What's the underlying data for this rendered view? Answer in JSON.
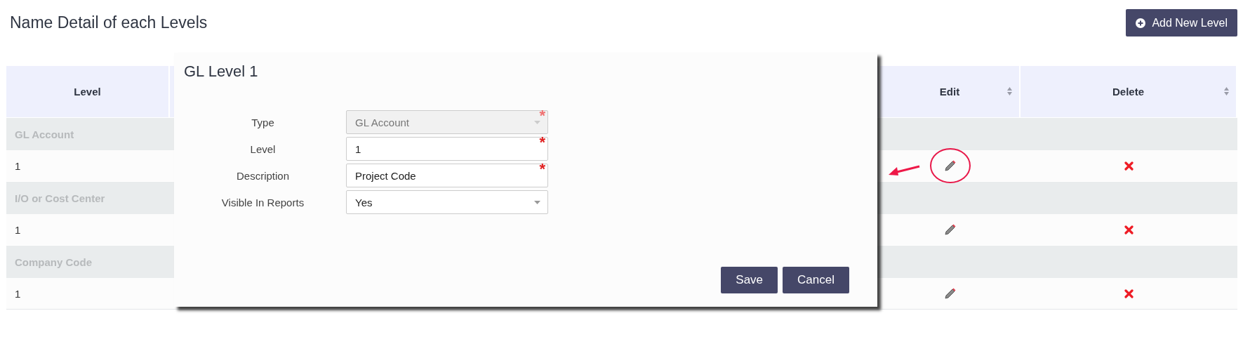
{
  "page": {
    "title": "Name Detail of each Levels",
    "add_button": "Add New Level"
  },
  "table": {
    "columns": [
      {
        "kind": "text",
        "label": "Level",
        "sortable": false
      },
      {
        "kind": "hidden"
      },
      {
        "kind": "edit",
        "label": "Edit",
        "sortable": true
      },
      {
        "kind": "delete",
        "label": "Delete",
        "sortable": true
      }
    ],
    "groups": [
      {
        "name": "GL Account",
        "rows": [
          {
            "level": "1",
            "annotated": true
          }
        ]
      },
      {
        "name": "I/O or Cost Center",
        "rows": [
          {
            "level": "1",
            "annotated": false
          }
        ]
      },
      {
        "name": "Company Code",
        "rows": [
          {
            "level": "1",
            "annotated": false
          }
        ]
      }
    ]
  },
  "dialog": {
    "title": "GL Level 1",
    "fields": [
      {
        "label": "Type",
        "kind": "select",
        "value": "GL Account",
        "disabled": true,
        "marker": "*"
      },
      {
        "label": "Level",
        "kind": "input",
        "value": "1",
        "disabled": false,
        "marker": "*"
      },
      {
        "label": "Description",
        "kind": "input",
        "value": "Project Code",
        "disabled": false,
        "marker": "*"
      },
      {
        "label": "Visible In Reports",
        "kind": "select",
        "value": "Yes",
        "disabled": false
      }
    ],
    "buttons": [
      "Save",
      "Cancel"
    ]
  }
}
